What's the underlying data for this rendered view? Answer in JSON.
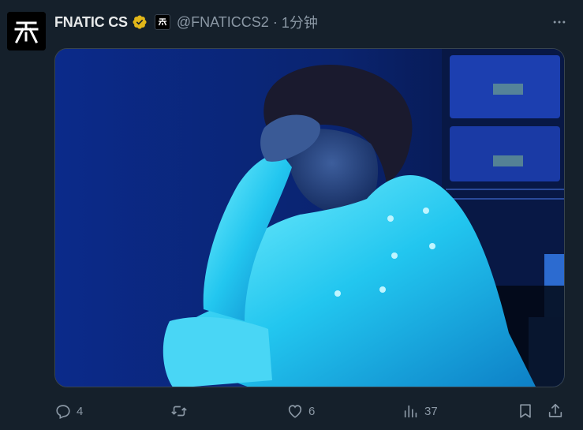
{
  "tweet": {
    "display_name": "FNATIC CS",
    "handle": "@FNATICCS2",
    "separator": "·",
    "time": "1分钟",
    "avatar_icon": "fnatic-logo",
    "verified_icon": "verified-badge-icon",
    "affiliation_icon": "fnatic-affiliate-badge",
    "media_description_icon": "chef-photo",
    "actions": {
      "reply_count": "4",
      "retweet_count": "",
      "like_count": "6",
      "views_count": "37"
    }
  },
  "colors": {
    "background": "#15202b",
    "text_primary": "#e7e9ea",
    "text_secondary": "#8b98a5",
    "verified_gold": "#e2b719",
    "border": "#38444d"
  }
}
